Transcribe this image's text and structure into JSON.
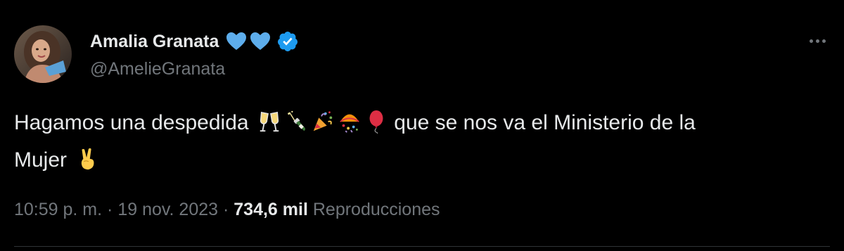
{
  "user": {
    "display_name": "Amalia Granata",
    "handle": "@AmelieGranata",
    "name_emojis": [
      "blue-heart-icon",
      "blue-heart-icon"
    ],
    "verified": true
  },
  "tweet": {
    "text_part1": "Hagamos una despedida",
    "text_part2": "que se nos va el Ministerio de la",
    "text_part3": "Mujer",
    "emojis_inline": [
      "clinking-glasses-icon",
      "champagne-icon",
      "party-popper-icon",
      "confetti-ball-icon",
      "balloon-icon"
    ],
    "emoji_end": "victory-hand-icon"
  },
  "meta": {
    "time": "10:59 p. m.",
    "separator": "·",
    "date": "19 nov. 2023",
    "views_count": "734,6 mil",
    "views_label": "Reproducciones"
  },
  "colors": {
    "background": "#000000",
    "text_primary": "#e7e9ea",
    "text_secondary": "#71767b",
    "verified_blue": "#1d9bf0",
    "heart_blue": "#5dadec"
  }
}
